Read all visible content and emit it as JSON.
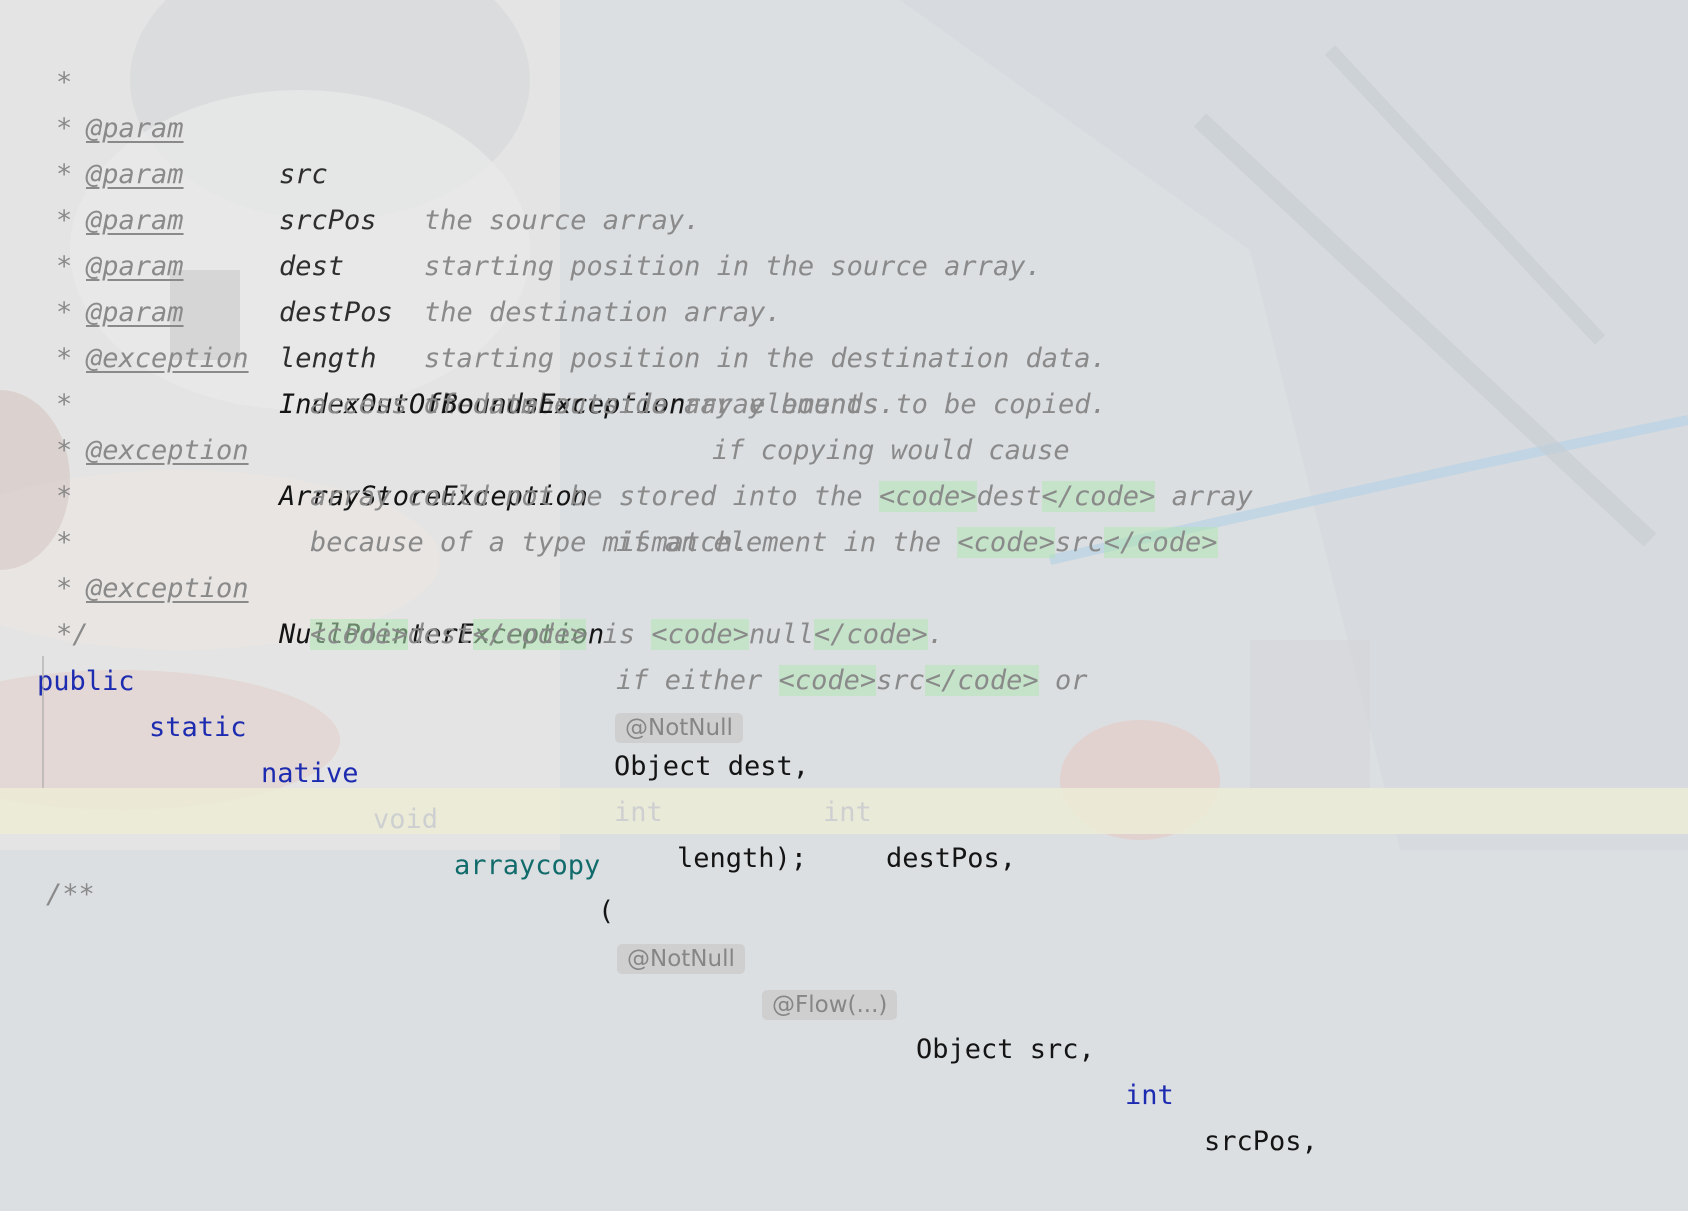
{
  "javadoc": {
    "star": "*",
    "end": "*/",
    "next_comment_start": "/**",
    "params": [
      {
        "tag": "@param",
        "name": "src",
        "desc": "the source array."
      },
      {
        "tag": "@param",
        "name": "srcPos",
        "desc": "starting position in the source array."
      },
      {
        "tag": "@param",
        "name": "dest",
        "desc": "the destination array."
      },
      {
        "tag": "@param",
        "name": "destPos",
        "desc": "starting position in the destination data."
      },
      {
        "tag": "@param",
        "name": "length",
        "desc": "the number of array elements to be copied."
      }
    ],
    "exceptions": [
      {
        "tag": "@exception",
        "name": "IndexOutOfBoundsException",
        "line1": "if copying would cause",
        "line2": "access of data outside array bounds."
      },
      {
        "tag": "@exception",
        "name": "ArrayStoreException",
        "line1_pre": "if an element in the ",
        "line1_open": "<code>",
        "line1_code": "src",
        "line1_close": "</code>",
        "line2_pre": "array could not be stored into the ",
        "line2_open": "<code>",
        "line2_code": "dest",
        "line2_close": "</code>",
        "line2_post": " array",
        "line3": "because of a type mismatch."
      },
      {
        "tag": "@exception",
        "name": "NullPointerException",
        "line1_pre": "if either ",
        "line1_open": "<code>",
        "line1_code": "src",
        "line1_close": "</code>",
        "line1_post": " or",
        "line2_open1": "<code>",
        "line2_code1": "dest",
        "line2_close1": "</code>",
        "line2_mid": " is ",
        "line2_open2": "<code>",
        "line2_code2": "null",
        "line2_close2": "</code>",
        "line2_post": "."
      }
    ]
  },
  "signature": {
    "kw_public": "public",
    "kw_static": "static",
    "kw_native": "native",
    "kw_void": "void",
    "method": "arraycopy",
    "open_paren": "(",
    "hint_notnull": "@NotNull",
    "hint_flow": "@Flow(...)",
    "p1": "Object src,",
    "kw_int": "int",
    "p2": "srcPos,",
    "hint_notnull2": "@NotNull",
    "p3": "Object dest,",
    "p4": "destPos,",
    "p5": "length);"
  }
}
